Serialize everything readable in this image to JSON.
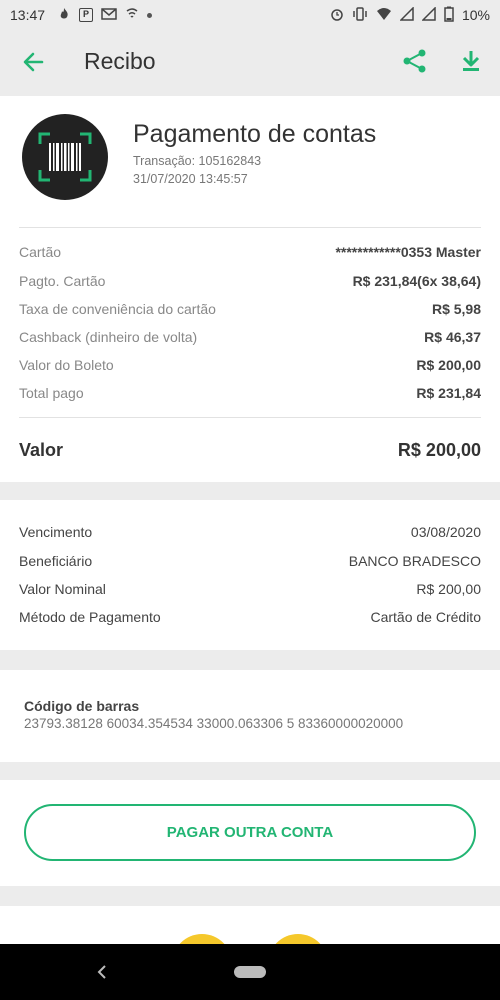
{
  "status_bar": {
    "time": "13:47",
    "battery": "10%",
    "icons": [
      "fire-icon",
      "parking-icon",
      "mail-icon",
      "wifi-arrows-icon",
      "dot-icon",
      "alarm-icon",
      "vibrate-icon",
      "wifi-icon",
      "signal-icon",
      "signal-icon",
      "battery-icon"
    ]
  },
  "app_bar": {
    "title": "Recibo",
    "icons": [
      "back-arrow-icon",
      "share-icon",
      "download-icon"
    ],
    "accent": "#22b573"
  },
  "header": {
    "title": "Pagamento de contas",
    "transaction": "Transação: 105162843",
    "datetime": "31/07/2020 13:45:57"
  },
  "payment_rows": [
    {
      "label": "Cartão",
      "value": "************0353 Master"
    },
    {
      "label": "Pagto. Cartão",
      "value": "R$ 231,84(6x 38,64)"
    },
    {
      "label": "Taxa de conveniência do cartão",
      "value": "R$ 5,98"
    },
    {
      "label": "Cashback (dinheiro de volta)",
      "value": "R$ 46,37"
    },
    {
      "label": "Valor do Boleto",
      "value": "R$ 200,00"
    },
    {
      "label": "Total pago",
      "value": "R$ 231,84"
    }
  ],
  "valor": {
    "label": "Valor",
    "value": "R$ 200,00"
  },
  "boleto_rows": [
    {
      "label": "Vencimento",
      "value": "03/08/2020"
    },
    {
      "label": "Beneficiário",
      "value": "BANCO BRADESCO"
    },
    {
      "label": "Valor Nominal",
      "value": "R$ 200,00"
    },
    {
      "label": "Método de Pagamento",
      "value": "Cartão de Crédito"
    }
  ],
  "barcode": {
    "label": "Código de barras",
    "value": "23793.38128 60034.354534 33000.063306 5 83360000020000"
  },
  "actions": {
    "pay_another": "PAGAR OUTRA CONTA"
  }
}
